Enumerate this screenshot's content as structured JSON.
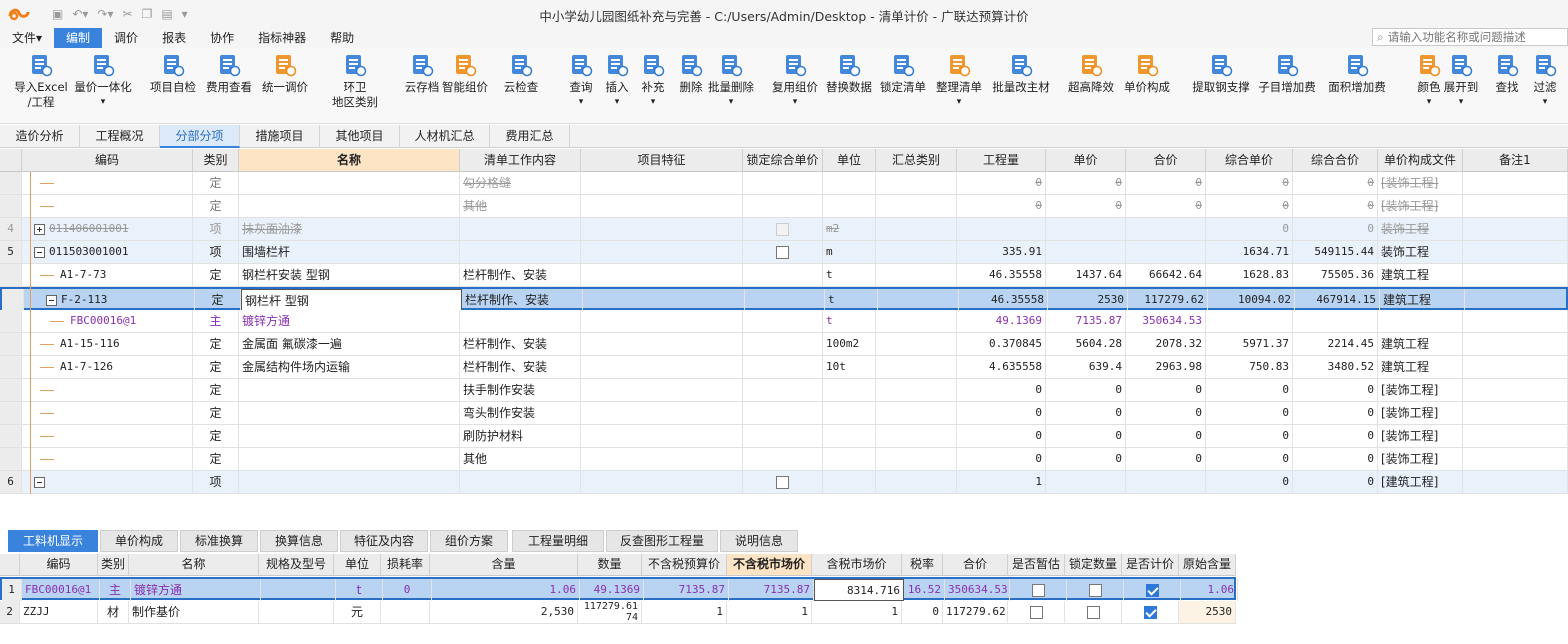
{
  "window": {
    "title": "中小学幼儿园图纸补充与完善 - C:/Users/Admin/Desktop - 清单计价 - 广联达预算计价"
  },
  "menus": [
    "文件",
    "编制",
    "调价",
    "报表",
    "协作",
    "指标神器",
    "帮助"
  ],
  "active_menu": "编制",
  "search": {
    "placeholder": "请输入功能名称或问题描述"
  },
  "ribbon": [
    {
      "l1": "导入Excel",
      "l2": "/工程",
      "icon": "excel-import-icon"
    },
    {
      "l1": "量价一体化",
      "l2": "",
      "icon": "bar-chart-icon"
    },
    {
      "l1": "项目自检",
      "l2": "",
      "icon": "check-doc-icon"
    },
    {
      "l1": "费用查看",
      "l2": "",
      "icon": "money-doc-icon"
    },
    {
      "l1": "统一调价",
      "l2": "",
      "icon": "price-adjust-icon"
    },
    {
      "l1": "环卫",
      "l2": "地区类别",
      "icon": "grid-icon"
    },
    {
      "l1": "云存档",
      "l2": "",
      "icon": "cloud-upload-icon"
    },
    {
      "l1": "智能组价",
      "l2": "",
      "icon": "smart-price-icon"
    },
    {
      "l1": "云检查",
      "l2": "",
      "icon": "cloud-check-icon"
    },
    {
      "l1": "查询",
      "l2": "",
      "icon": "search-icon"
    },
    {
      "l1": "插入",
      "l2": "",
      "icon": "insert-icon"
    },
    {
      "l1": "补充",
      "l2": "",
      "icon": "supplement-icon"
    },
    {
      "l1": "删除",
      "l2": "",
      "icon": "trash-icon"
    },
    {
      "l1": "批量删除",
      "l2": "",
      "icon": "batch-delete-icon"
    },
    {
      "l1": "复用组价",
      "l2": "",
      "icon": "reuse-icon"
    },
    {
      "l1": "替换数据",
      "l2": "",
      "icon": "replace-icon"
    },
    {
      "l1": "锁定清单",
      "l2": "",
      "icon": "lock-icon"
    },
    {
      "l1": "整理清单",
      "l2": "",
      "icon": "organize-icon"
    },
    {
      "l1": "批量改主材",
      "l2": "",
      "icon": "edit-material-icon"
    },
    {
      "l1": "超高降效",
      "l2": "",
      "icon": "height-icon"
    },
    {
      "l1": "单价构成",
      "l2": "",
      "icon": "unit-price-icon"
    },
    {
      "l1": "提取钢支撑",
      "l2": "",
      "icon": "steel-support-icon"
    },
    {
      "l1": "子目增加费",
      "l2": "",
      "icon": "sub-fee-icon"
    },
    {
      "l1": "面积增加费",
      "l2": "",
      "icon": "area-fee-icon"
    },
    {
      "l1": "颜色",
      "l2": "",
      "icon": "color-icon"
    },
    {
      "l1": "展开到",
      "l2": "",
      "icon": "expand-icon"
    },
    {
      "l1": "查找",
      "l2": "",
      "icon": "binoculars-icon"
    },
    {
      "l1": "过滤",
      "l2": "",
      "icon": "filter-icon"
    }
  ],
  "tabs": [
    "造价分析",
    "工程概况",
    "分部分项",
    "措施项目",
    "其他项目",
    "人材机汇总",
    "费用汇总"
  ],
  "active_tab": "分部分项",
  "grid_headers": [
    "编码",
    "类别",
    "名称",
    "清单工作内容",
    "项目特征",
    "锁定综合单价",
    "单位",
    "汇总类别",
    "工程量",
    "单价",
    "合价",
    "综合单价",
    "综合合价",
    "单价构成文件",
    "备注1"
  ],
  "grid_rows": [
    {
      "no": "",
      "code": "",
      "cat": "定",
      "name": "",
      "work": "勾分格缝",
      "unit": "",
      "qty": "0",
      "price": "0",
      "total": "0",
      "cprice": "0",
      "ctotal": "0",
      "file": "[装饰工程]",
      "style": "strike"
    },
    {
      "no": "",
      "code": "",
      "cat": "定",
      "name": "",
      "work": "其他",
      "unit": "",
      "qty": "0",
      "price": "0",
      "total": "0",
      "cprice": "0",
      "ctotal": "0",
      "file": "[装饰工程]",
      "style": "strike"
    },
    {
      "no": "4",
      "code": "011406001001",
      "cat": "项",
      "name": "抹灰面油漆",
      "work": "",
      "unit": "m2",
      "qty": "",
      "price": "",
      "total": "",
      "cprice": "0",
      "ctotal": "0",
      "file": "装饰工程",
      "style": "strike-item"
    },
    {
      "no": "5",
      "code": "011503001001",
      "cat": "项",
      "name": "围墙栏杆",
      "work": "",
      "unit": "m",
      "qty": "335.91",
      "price": "",
      "total": "",
      "cprice": "1634.71",
      "ctotal": "549115.44",
      "file": "装饰工程",
      "style": "item"
    },
    {
      "no": "",
      "code": "A1-7-73",
      "cat": "定",
      "name": "钢栏杆安装 型钢",
      "work": "栏杆制作、安装",
      "unit": "t",
      "qty": "46.35558",
      "price": "1437.64",
      "total": "66642.64",
      "cprice": "1628.83",
      "ctotal": "75505.36",
      "file": "建筑工程",
      "style": "normal"
    },
    {
      "no": "",
      "code": "F-2-113",
      "cat": "定",
      "name": "钢栏杆 型钢",
      "work": "栏杆制作、安装",
      "unit": "t",
      "qty": "46.35558",
      "price": "2530",
      "total": "117279.62",
      "cprice": "10094.02",
      "ctotal": "467914.15",
      "file": "建筑工程",
      "style": "selected"
    },
    {
      "no": "",
      "code": "FBC00016@1",
      "cat": "主",
      "name": "镀锌方通",
      "work": "",
      "unit": "t",
      "qty": "49.1369",
      "price": "7135.87",
      "total": "350634.53",
      "cprice": "",
      "ctotal": "",
      "file": "",
      "style": "purple"
    },
    {
      "no": "",
      "code": "A1-15-116",
      "cat": "定",
      "name": "金属面 氟碳漆一遍",
      "work": "栏杆制作、安装",
      "unit": "100m2",
      "qty": "0.370845",
      "price": "5604.28",
      "total": "2078.32",
      "cprice": "5971.37",
      "ctotal": "2214.45",
      "file": "建筑工程",
      "style": "normal"
    },
    {
      "no": "",
      "code": "A1-7-126",
      "cat": "定",
      "name": "金属结构件场内运输",
      "work": "栏杆制作、安装",
      "unit": "10t",
      "qty": "4.635558",
      "price": "639.4",
      "total": "2963.98",
      "cprice": "750.83",
      "ctotal": "3480.52",
      "file": "建筑工程",
      "style": "normal"
    },
    {
      "no": "",
      "code": "",
      "cat": "定",
      "name": "",
      "work": "扶手制作安装",
      "unit": "",
      "qty": "0",
      "price": "0",
      "total": "0",
      "cprice": "0",
      "ctotal": "0",
      "file": "[装饰工程]",
      "style": "normal"
    },
    {
      "no": "",
      "code": "",
      "cat": "定",
      "name": "",
      "work": "弯头制作安装",
      "unit": "",
      "qty": "0",
      "price": "0",
      "total": "0",
      "cprice": "0",
      "ctotal": "0",
      "file": "[装饰工程]",
      "style": "normal"
    },
    {
      "no": "",
      "code": "",
      "cat": "定",
      "name": "",
      "work": "刷防护材料",
      "unit": "",
      "qty": "0",
      "price": "0",
      "total": "0",
      "cprice": "0",
      "ctotal": "0",
      "file": "[装饰工程]",
      "style": "normal"
    },
    {
      "no": "",
      "code": "",
      "cat": "定",
      "name": "",
      "work": "其他",
      "unit": "",
      "qty": "0",
      "price": "0",
      "total": "0",
      "cprice": "0",
      "ctotal": "0",
      "file": "[装饰工程]",
      "style": "normal"
    },
    {
      "no": "6",
      "code": "",
      "cat": "项",
      "name": "",
      "work": "",
      "unit": "",
      "qty": "1",
      "price": "",
      "total": "",
      "cprice": "0",
      "ctotal": "0",
      "file": "[建筑工程]",
      "style": "item"
    }
  ],
  "bottom_tabs": [
    "工料机显示",
    "单价构成",
    "标准换算",
    "换算信息",
    "特征及内容",
    "组价方案",
    "工程量明细",
    "反查图形工程量",
    "说明信息"
  ],
  "active_bottom_tab": "工料机显示",
  "bottom_headers": [
    "编码",
    "类别",
    "名称",
    "规格及型号",
    "单位",
    "损耗率",
    "含量",
    "数量",
    "不含税预算价",
    "不含税市场价",
    "含税市场价",
    "税率",
    "合价",
    "是否暂估",
    "锁定数量",
    "是否计价",
    "原始含量"
  ],
  "bottom_rows": [
    {
      "no": "1",
      "code": "FBC00016@1",
      "cat": "主",
      "name": "镀锌方通",
      "spec": "",
      "unit": "t",
      "loss": "0",
      "content": "1.06",
      "qty": "49.1369",
      "budget": "7135.87",
      "market": "7135.87",
      "taxmarket": "8314.716",
      "tax": "16.52",
      "total": "350634.53",
      "est": false,
      "lock": false,
      "priced": true,
      "orig": "1.06",
      "style": "selected"
    },
    {
      "no": "2",
      "code": "ZZJJ",
      "cat": "材",
      "name": "制作基价",
      "spec": "",
      "unit": "元",
      "loss": "",
      "content": "2,530",
      "qty": "117279.6174",
      "budget": "1",
      "market": "1",
      "taxmarket": "1",
      "tax": "0",
      "total": "117279.62",
      "est": false,
      "lock": false,
      "priced": true,
      "orig": "2530",
      "style": "normal"
    }
  ]
}
